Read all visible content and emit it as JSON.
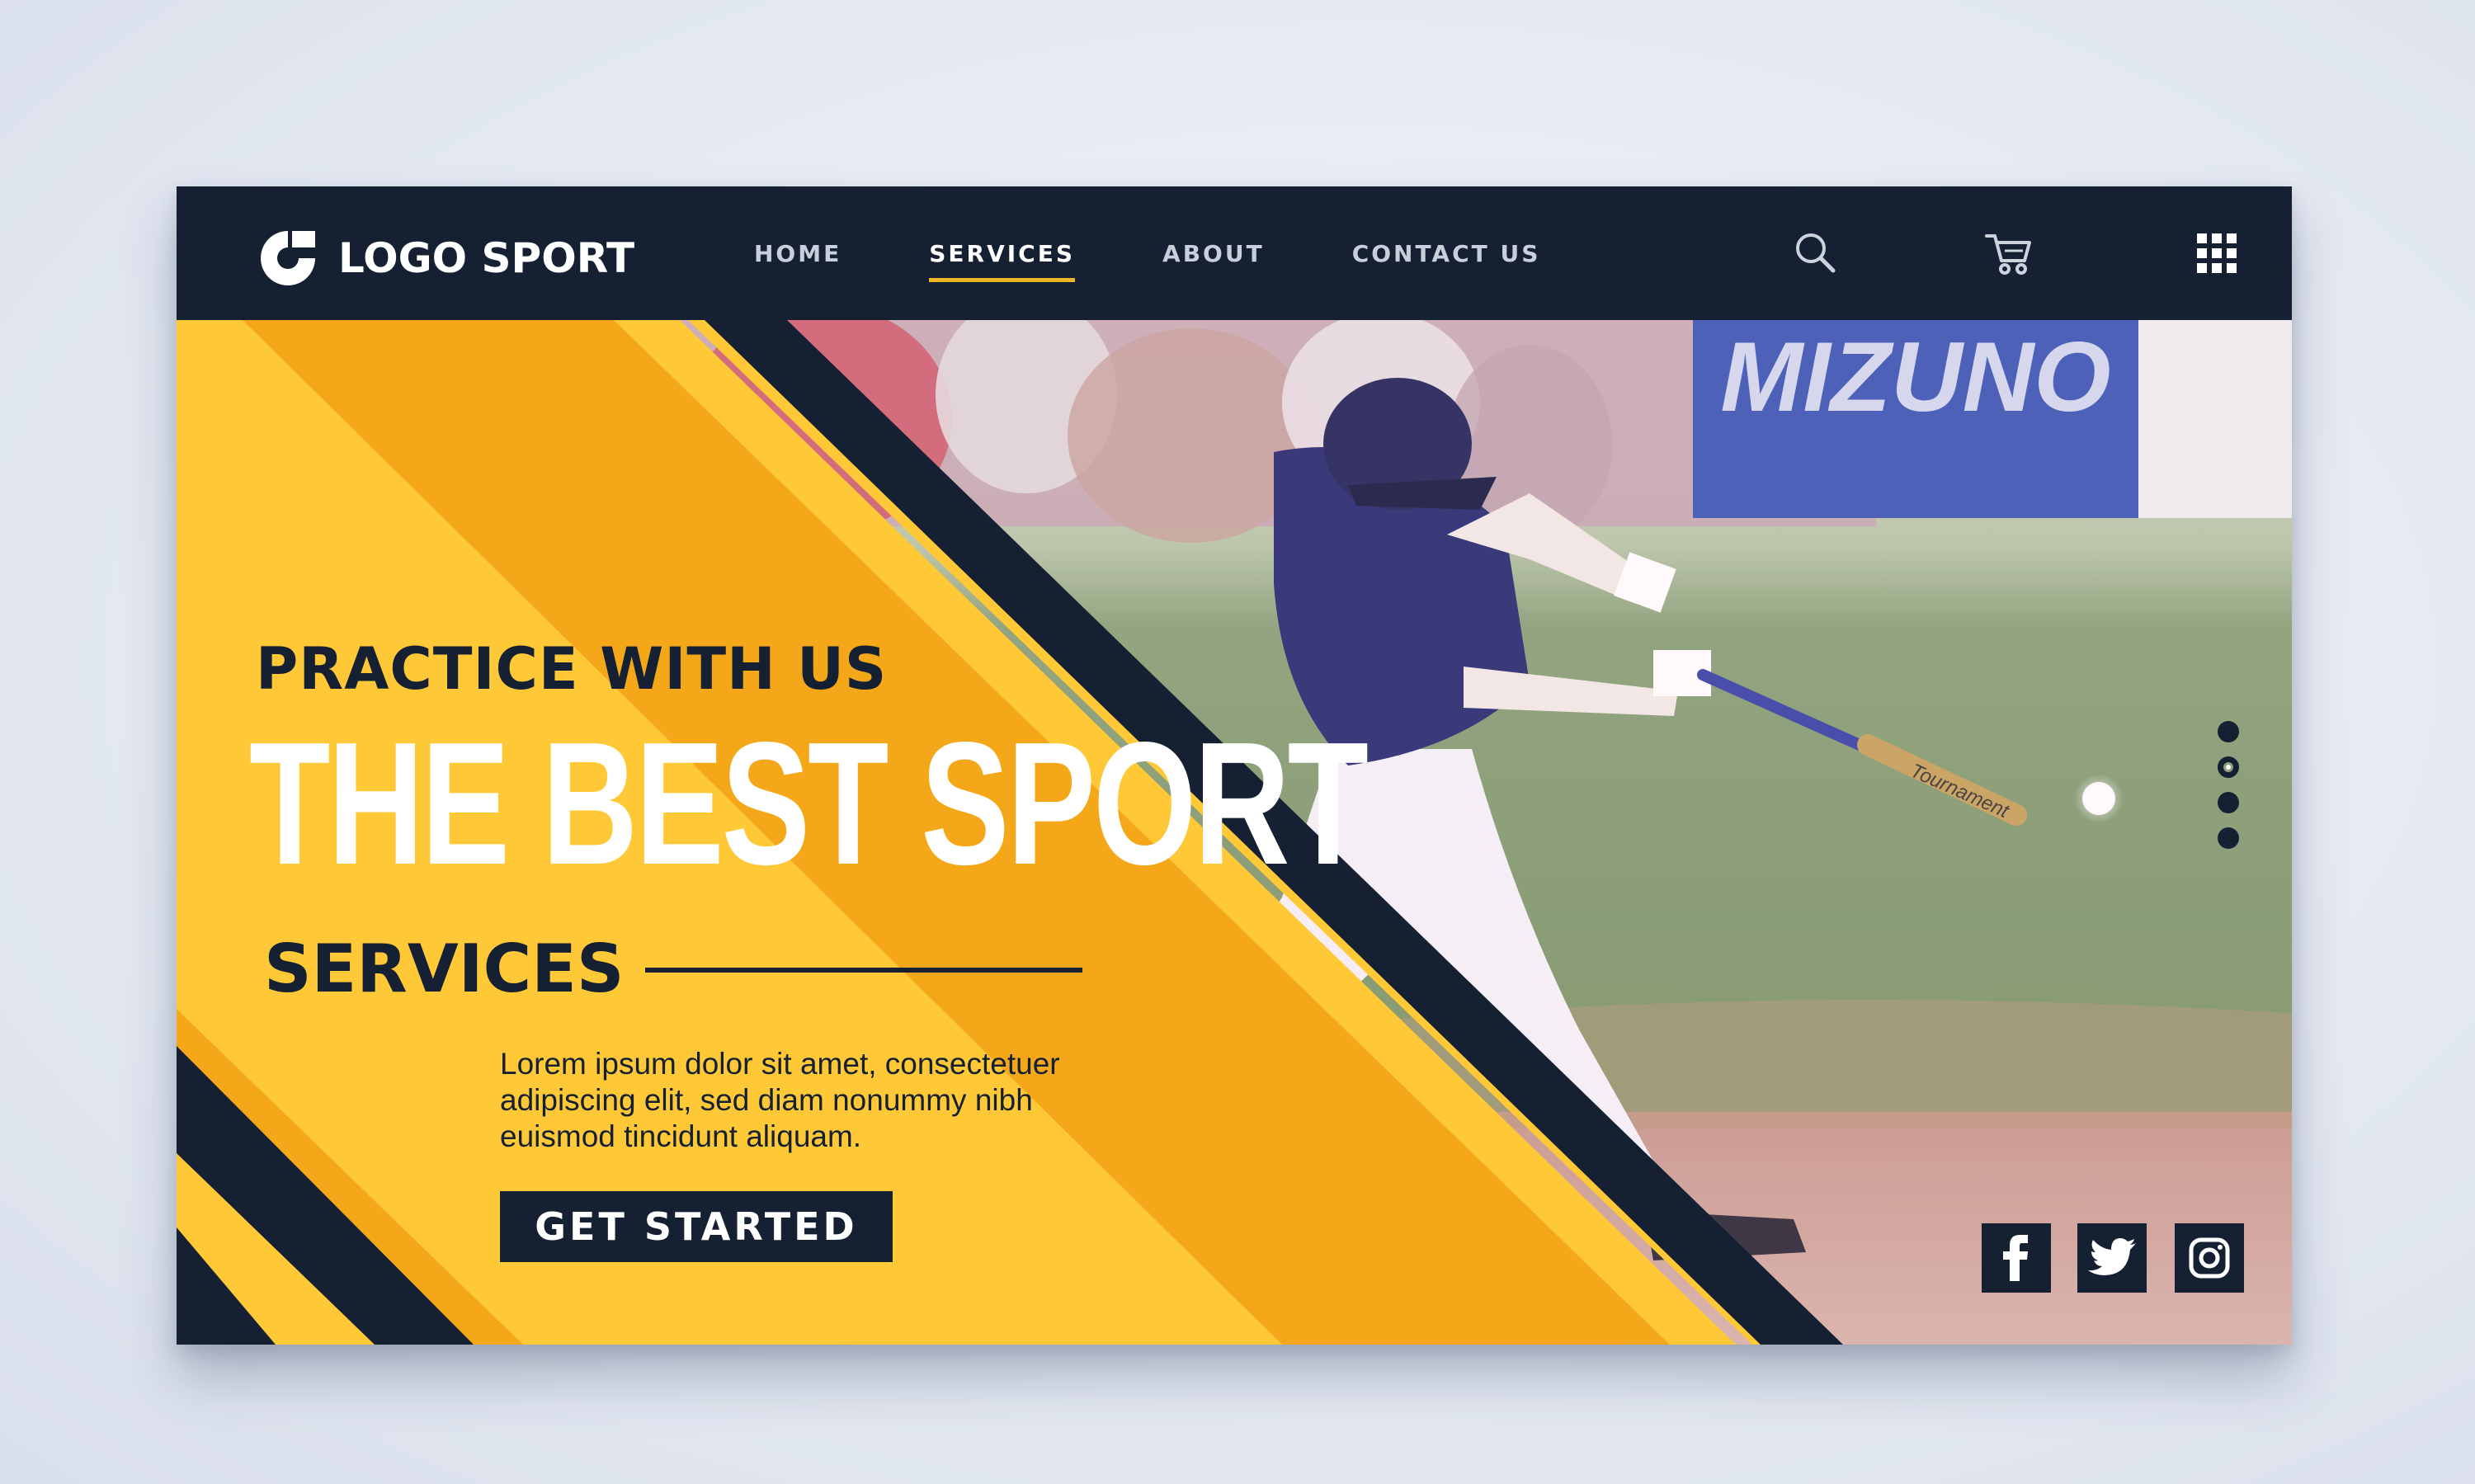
{
  "brand": {
    "name": "LOGO SPORT"
  },
  "nav": {
    "items": [
      {
        "label": "HOME",
        "active": false
      },
      {
        "label": "SERVICES",
        "active": true
      },
      {
        "label": "ABOUT",
        "active": false
      },
      {
        "label": "CONTACT US",
        "active": false
      }
    ],
    "icons": [
      "search-icon",
      "cart-icon",
      "grid-menu-icon"
    ]
  },
  "hero": {
    "pretitle": "PRACTICE WITH US",
    "title": "THE BEST SPORT",
    "subtitle": "SERVICES",
    "body": "Lorem ipsum dolor sit amet, consectetuer adipiscing elit, sed diam nonummy nibh euismod tincidunt aliquam.",
    "cta_label": "GET STARTED",
    "banner_text": "MIZUNO",
    "bat_text": "Tournament"
  },
  "slider": {
    "count": 4,
    "active_index": 1
  },
  "social": [
    "facebook-icon",
    "twitter-icon",
    "instagram-icon"
  ],
  "colors": {
    "navy": "#162033",
    "yellow": "#fec837",
    "orange": "#f5a71a",
    "accent_underline": "#f2b623"
  }
}
